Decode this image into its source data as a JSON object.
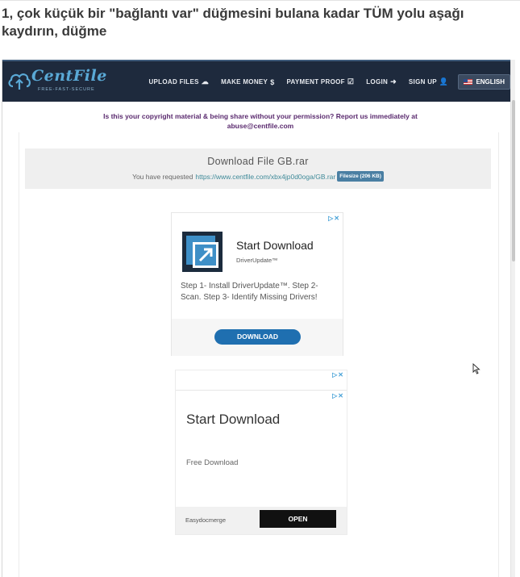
{
  "article": {
    "title": "1, çok küçük bir \"bağlantı var\" düğmesini bulana kadar TÜM yolu aşağı kaydırın, düğme"
  },
  "site": {
    "brand": "CentFile",
    "tagline": "FREE-FAST-SECURE",
    "nav": [
      {
        "label": "UPLOAD FILES",
        "icon": "cloud-upload-icon",
        "glyph": "☁"
      },
      {
        "label": "MAKE MONEY",
        "icon": "dollar-icon",
        "glyph": "$"
      },
      {
        "label": "PAYMENT PROOF",
        "icon": "checkbox-icon",
        "glyph": "☑"
      },
      {
        "label": "LOGIN",
        "icon": "sign-in-icon",
        "glyph": "➜"
      },
      {
        "label": "SIGN UP",
        "icon": "user-plus-icon",
        "glyph": "👤"
      }
    ],
    "language": "ENGLISH",
    "notice_line1": "Is this your copyright material & being share without your permission? Report us immediately at",
    "notice_line2": "abuse@centfile.com"
  },
  "download": {
    "title": "Download File GB.rar",
    "request_prefix": "You have requested",
    "url": "https://www.centfile.com/xbx4jp0d0oga/GB.rar",
    "filesize": "Filesize (206 KB)"
  },
  "ads": {
    "ad1": {
      "title": "Start Download",
      "advertiser": "DriverUpdate™",
      "description": "Step 1- Install DriverUpdate™. Step 2- Scan. Step 3- Identify Missing Drivers!",
      "button": "DOWNLOAD",
      "choices": "▷✕"
    },
    "ad2": {
      "title": "Start Download",
      "subtitle": "Free Download",
      "advertiser": "Easydocmerge",
      "button": "OPEN",
      "choices": "▷✕"
    }
  },
  "colors": {
    "navbar": "#1e2a3d",
    "brand": "#5aa9d6",
    "notice": "#5a2a6e",
    "link": "#3f8a99",
    "download_button": "#1f6fb0"
  }
}
